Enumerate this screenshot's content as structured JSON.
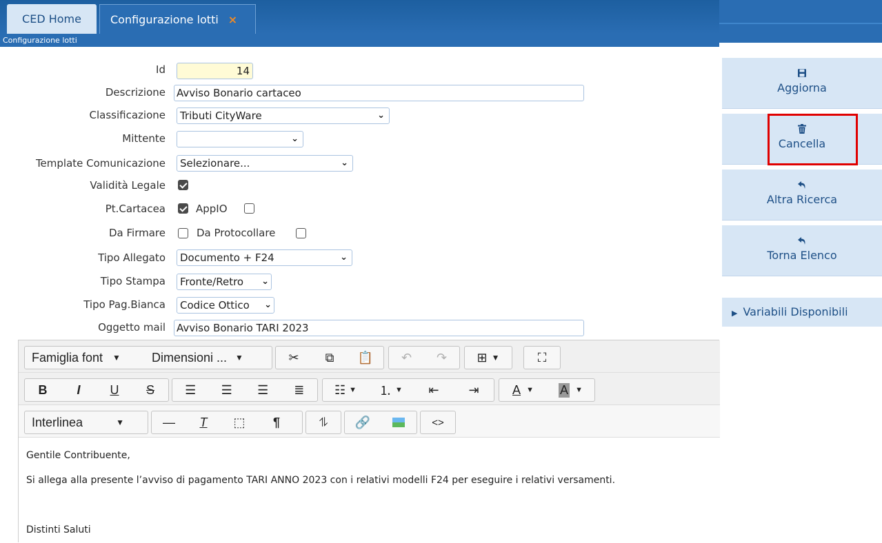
{
  "tabs": [
    {
      "label": "CED Home"
    },
    {
      "label": "Configurazione lotti",
      "close": "×"
    }
  ],
  "subtitle": "Configurazione lotti",
  "form": {
    "id": {
      "label": "Id",
      "value": "14"
    },
    "descrizione": {
      "label": "Descrizione",
      "value": "Avviso Bonario cartaceo"
    },
    "classificazione": {
      "label": "Classificazione",
      "value": "Tributi CityWare"
    },
    "mittente": {
      "label": "Mittente",
      "value": ""
    },
    "template": {
      "label": "Template Comunicazione",
      "value": "Selezionare..."
    },
    "validita": {
      "label": "Validità Legale",
      "checked": true
    },
    "ptcartacea": {
      "label": "Pt.Cartacea",
      "checked": true
    },
    "appio": {
      "label": "AppIO",
      "checked": false
    },
    "dafirmare": {
      "label": "Da Firmare",
      "checked": false
    },
    "daprotocollare": {
      "label": "Da Protocollare",
      "checked": false
    },
    "tipoallegato": {
      "label": "Tipo Allegato",
      "value": "Documento + F24"
    },
    "tipostampa": {
      "label": "Tipo Stampa",
      "value": "Fronte/Retro"
    },
    "tipopag": {
      "label": "Tipo Pag.Bianca",
      "value": "Codice Ottico"
    },
    "oggetto": {
      "label": "Oggetto mail",
      "value": "Avviso Bonario TARI 2023"
    }
  },
  "actions": {
    "aggiorna": {
      "label": "Aggiorna",
      "icon": "save-icon"
    },
    "cancella": {
      "label": "Cancella",
      "icon": "trash-icon"
    },
    "altra": {
      "label": "Altra Ricerca",
      "icon": "back-icon"
    },
    "torna": {
      "label": "Torna Elenco",
      "icon": "back-icon"
    },
    "variabili": {
      "label": "Variabili Disponibili"
    }
  },
  "editor": {
    "font_family": "Famiglia font",
    "font_size": "Dimensioni ...",
    "line_height": "Interlinea",
    "content": [
      "Gentile Contribuente,",
      "Si allega alla presente l’avviso di pagamento TARI ANNO 2023 con i relativi modelli F24 per eseguire i relativi versamenti.",
      "",
      "Distinti Saluti"
    ]
  },
  "colors": {
    "header": "#2a6db3",
    "panel": "#d7e6f5",
    "highlight": "#e00000"
  }
}
